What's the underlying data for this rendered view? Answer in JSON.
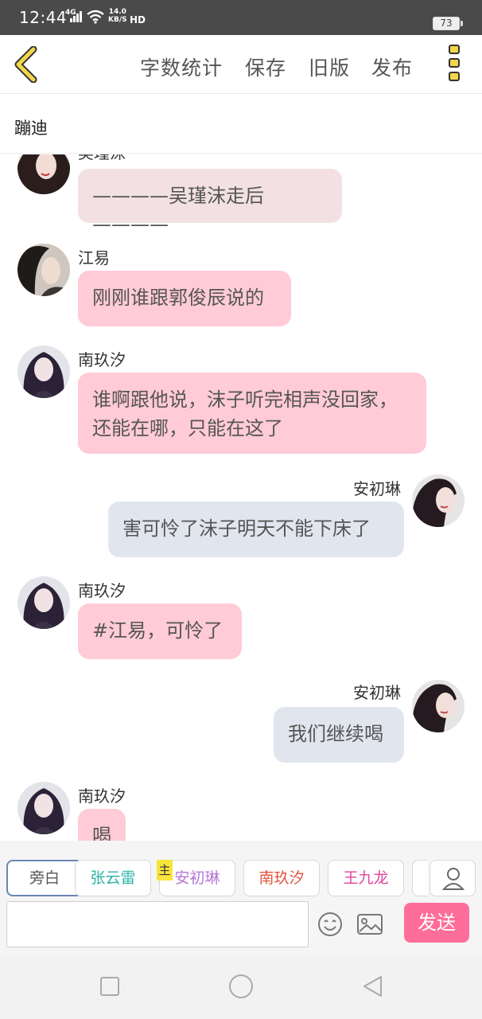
{
  "status_bar": {
    "time": "12:44",
    "network": "4G",
    "speed_value": "14.0",
    "speed_unit": "KB/S",
    "hd": "HD",
    "battery": "73"
  },
  "toolbar": {
    "word_count": "字数统计",
    "save": "保存",
    "old_version": "旧版",
    "publish": "发布"
  },
  "chat": {
    "title": "蹦迪"
  },
  "messages": [
    {
      "name": "吴瑾沫",
      "text": "————吴瑾沫走后————",
      "side": "left"
    },
    {
      "name": "江易",
      "text": "刚刚谁跟郭俊辰说的",
      "side": "left"
    },
    {
      "name": "南玖汐",
      "text": "谁啊跟他说，沫子听完相声没回家，还能在哪，只能在这了",
      "side": "left"
    },
    {
      "name": "安初琳",
      "text": "害可怜了沫子明天不能下床了",
      "side": "right"
    },
    {
      "name": "南玖汐",
      "text": "#江易，可怜了",
      "side": "left"
    },
    {
      "name": "安初琳",
      "text": "我们继续喝",
      "side": "right"
    },
    {
      "name": "南玖汐",
      "text": "喝",
      "side": "left"
    }
  ],
  "roles": [
    {
      "label": "旁白",
      "color": "#555555"
    },
    {
      "label": "张云雷",
      "color": "#2bb5a6"
    },
    {
      "label": "安初琳",
      "color": "#b678d6"
    },
    {
      "label": "南玖汐",
      "color": "#e0533c"
    },
    {
      "label": "王九龙",
      "color": "#e0439e"
    }
  ],
  "host_tag": "主",
  "composer": {
    "input_value": "",
    "send_label": "发送"
  },
  "colors": {
    "accent_yellow": "#f2d54a",
    "send_pink": "#ff6d9b",
    "bubble_pink": "#ffcbd6",
    "bubble_blue": "#e1e6ee"
  }
}
